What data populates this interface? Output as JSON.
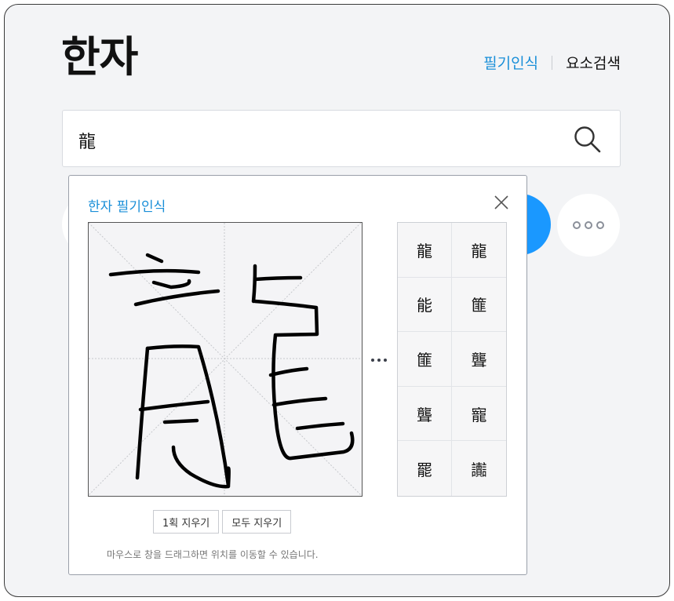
{
  "header": {
    "title": "한자",
    "links": [
      {
        "label": "필기인식",
        "active": true
      },
      {
        "label": "요소검색",
        "active": false
      }
    ]
  },
  "search": {
    "value": "龍"
  },
  "popup": {
    "title": "한자 필기인식",
    "candidates": [
      "龍",
      "龍",
      "能",
      "篚",
      "篚",
      "聾",
      "聾",
      "寵",
      "罷",
      "讟"
    ],
    "buttons": {
      "erase_stroke": "1획 지우기",
      "erase_all": "모두 지우기"
    },
    "help_text": "마우스로 창을 드래그하면 위치를 이동할 수 있습니다."
  },
  "colors": {
    "accent": "#1a8fd8",
    "blue_button": "#1a98ff",
    "background": "#f3f4f6"
  }
}
